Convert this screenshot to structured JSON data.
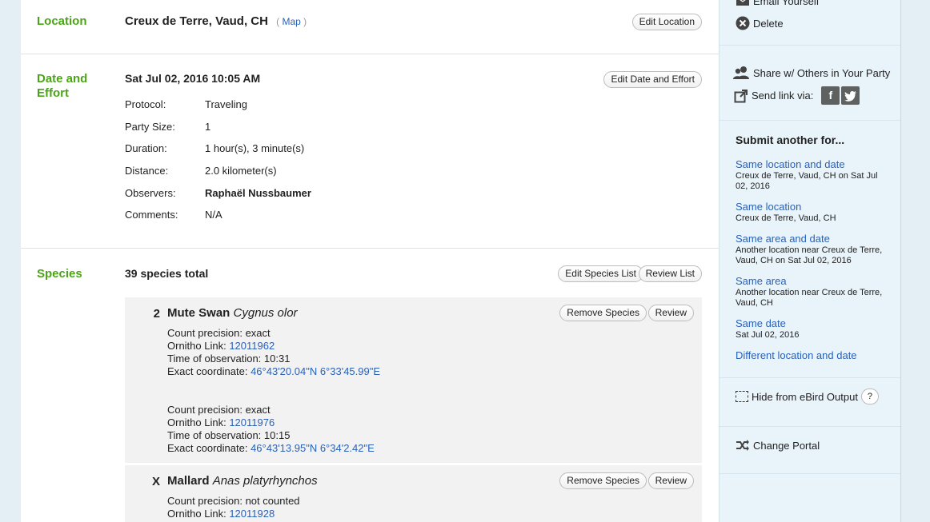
{
  "location": {
    "label": "Location",
    "name": "Creux de Terre, Vaud, CH",
    "map_open": "(",
    "map_link": "Map",
    "map_close": ")",
    "edit_button": "Edit Location"
  },
  "date_effort": {
    "label": "Date and Effort",
    "datetime": "Sat Jul 02, 2016 10:05 AM",
    "edit_button": "Edit Date and Effort",
    "fields": [
      {
        "key": "Protocol:",
        "value": "Traveling"
      },
      {
        "key": "Party Size:",
        "value": "1"
      },
      {
        "key": "Duration:",
        "value": "1 hour(s), 3 minute(s)"
      },
      {
        "key": "Distance:",
        "value": "2.0 kilometer(s)"
      },
      {
        "key": "Observers:",
        "value": "Raphaël Nussbaumer"
      },
      {
        "key": "Comments:",
        "value": "N/A"
      }
    ]
  },
  "species": {
    "label": "Species",
    "total": "39 species total",
    "edit_button": "Edit Species List",
    "review_list_button": "Review List",
    "remove_label": "Remove Species",
    "review_label": "Review",
    "items": [
      {
        "count": "2",
        "common": "Mute Swan",
        "scientific": "Cygnus olor",
        "observations": [
          {
            "precision_key": "Count precision:",
            "precision": "exact",
            "link_key": "Ornitho Link:",
            "link": "12011962",
            "time_key": "Time of observation:",
            "time": "10:31",
            "coord_key": "Exact coordinate:",
            "coord": "46°43'20.04\"N 6°33'45.99\"E"
          },
          {
            "precision_key": "Count precision:",
            "precision": "exact",
            "link_key": "Ornitho Link:",
            "link": "12011976",
            "time_key": "Time of observation:",
            "time": "10:15",
            "coord_key": "Exact coordinate:",
            "coord": "46°43'13.95\"N 6°34'2.42\"E"
          }
        ]
      },
      {
        "count": "X",
        "common": "Mallard",
        "scientific": "Anas platyrhynchos",
        "observations": [
          {
            "precision_key": "Count precision:",
            "precision": "not counted",
            "link_key": "Ornitho Link:",
            "link": "12011928"
          }
        ]
      }
    ]
  },
  "sidebar": {
    "email": "Email Yourself",
    "delete": "Delete",
    "share": "Share w/ Others in Your Party",
    "send_link": "Send link via:",
    "facebook": "f",
    "twitter": "t",
    "submit_heading": "Submit another for...",
    "submit_options": [
      {
        "link": "Same location and date",
        "sub": "Creux de Terre, Vaud, CH on Sat Jul 02, 2016"
      },
      {
        "link": "Same location",
        "sub": "Creux de Terre, Vaud, CH"
      },
      {
        "link": "Same area and date",
        "sub": "Another location near Creux de Terre, Vaud, CH on Sat Jul 02, 2016"
      },
      {
        "link": "Same area",
        "sub": "Another location near Creux de Terre, Vaud, CH"
      },
      {
        "link": "Same date",
        "sub": "Sat Jul 02, 2016"
      },
      {
        "link": "Different location and date",
        "sub": ""
      }
    ],
    "hide_label": "Hide from eBird Output",
    "help": "?",
    "change_portal": "Change Portal"
  }
}
